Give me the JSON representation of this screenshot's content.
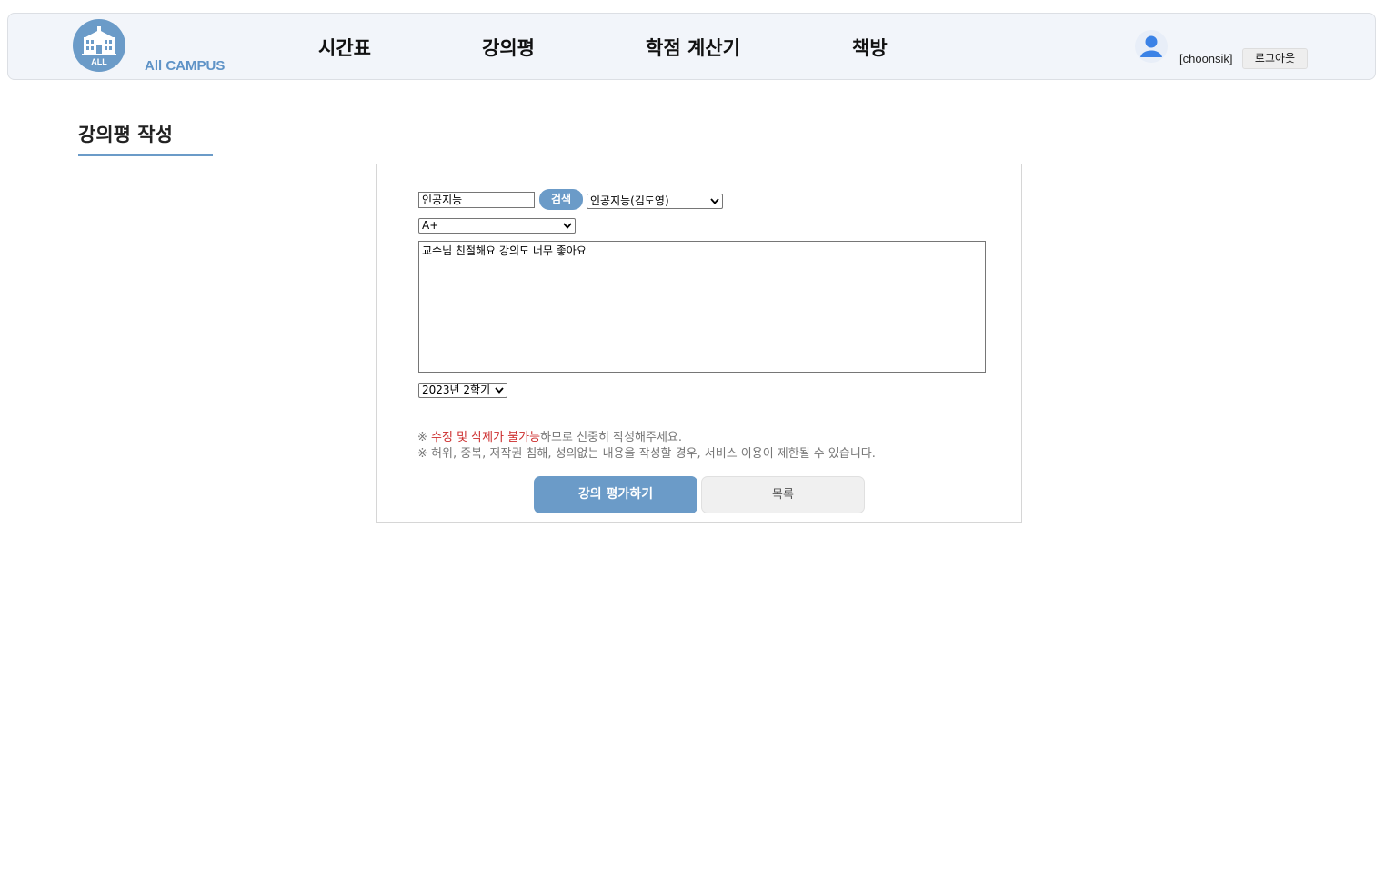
{
  "header": {
    "brand": "All CAMPUS",
    "logo_badge": "ALL",
    "nav": [
      {
        "label": "시간표"
      },
      {
        "label": "강의평"
      },
      {
        "label": "학점 계산기"
      },
      {
        "label": "책방"
      }
    ],
    "username": "[choonsik]",
    "logout_label": "로그아웃"
  },
  "page": {
    "title": "강의평 작성"
  },
  "form": {
    "course_search_value": "인공지능",
    "search_label": "검색",
    "course_selected": "인공지능(김도영)",
    "grade_selected": "A+",
    "review_text": "교수님 친절해요 강의도 너무 좋아요",
    "term_selected": "2023년 2학기",
    "notice1_prefix": "※ ",
    "notice1_warn": "수정 및 삭제가 불가능",
    "notice1_suffix": "하므로 신중히 작성해주세요.",
    "notice2": "※ 허위, 중복, 저작권 침해, 성의없는 내용을 작성할 경우, 서비스 이용이 제한될 수 있습니다.",
    "submit_label": "강의 평가하기",
    "list_label": "목록"
  },
  "colors": {
    "accent": "#6b9bc8",
    "warning": "#cc2b2b",
    "header_bg": "#f2f5fa"
  }
}
